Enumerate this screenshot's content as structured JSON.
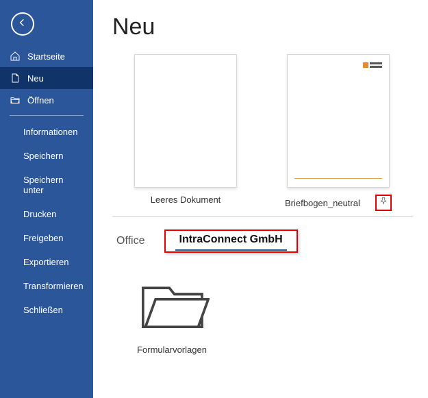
{
  "sidebar": {
    "primary": [
      {
        "icon": "home-icon",
        "label": "Startseite"
      },
      {
        "icon": "new-icon",
        "label": "Neu"
      },
      {
        "icon": "open-icon",
        "label": "Öffnen"
      }
    ],
    "secondary": [
      "Informationen",
      "Speichern",
      "Speichern unter",
      "Drucken",
      "Freigeben",
      "Exportieren",
      "Transformieren",
      "Schließen"
    ]
  },
  "page": {
    "title": "Neu"
  },
  "templates": [
    {
      "label": "Leeres Dokument",
      "variant": "blank"
    },
    {
      "label": "Briefbogen_neutral",
      "variant": "letterhead",
      "pin_highlight": true
    }
  ],
  "tabs": [
    {
      "label": "Office",
      "active": false,
      "highlight": false
    },
    {
      "label": "IntraConnect GmbH",
      "active": true,
      "highlight": true
    }
  ],
  "folders": [
    {
      "label": "Formularvorlagen"
    }
  ]
}
